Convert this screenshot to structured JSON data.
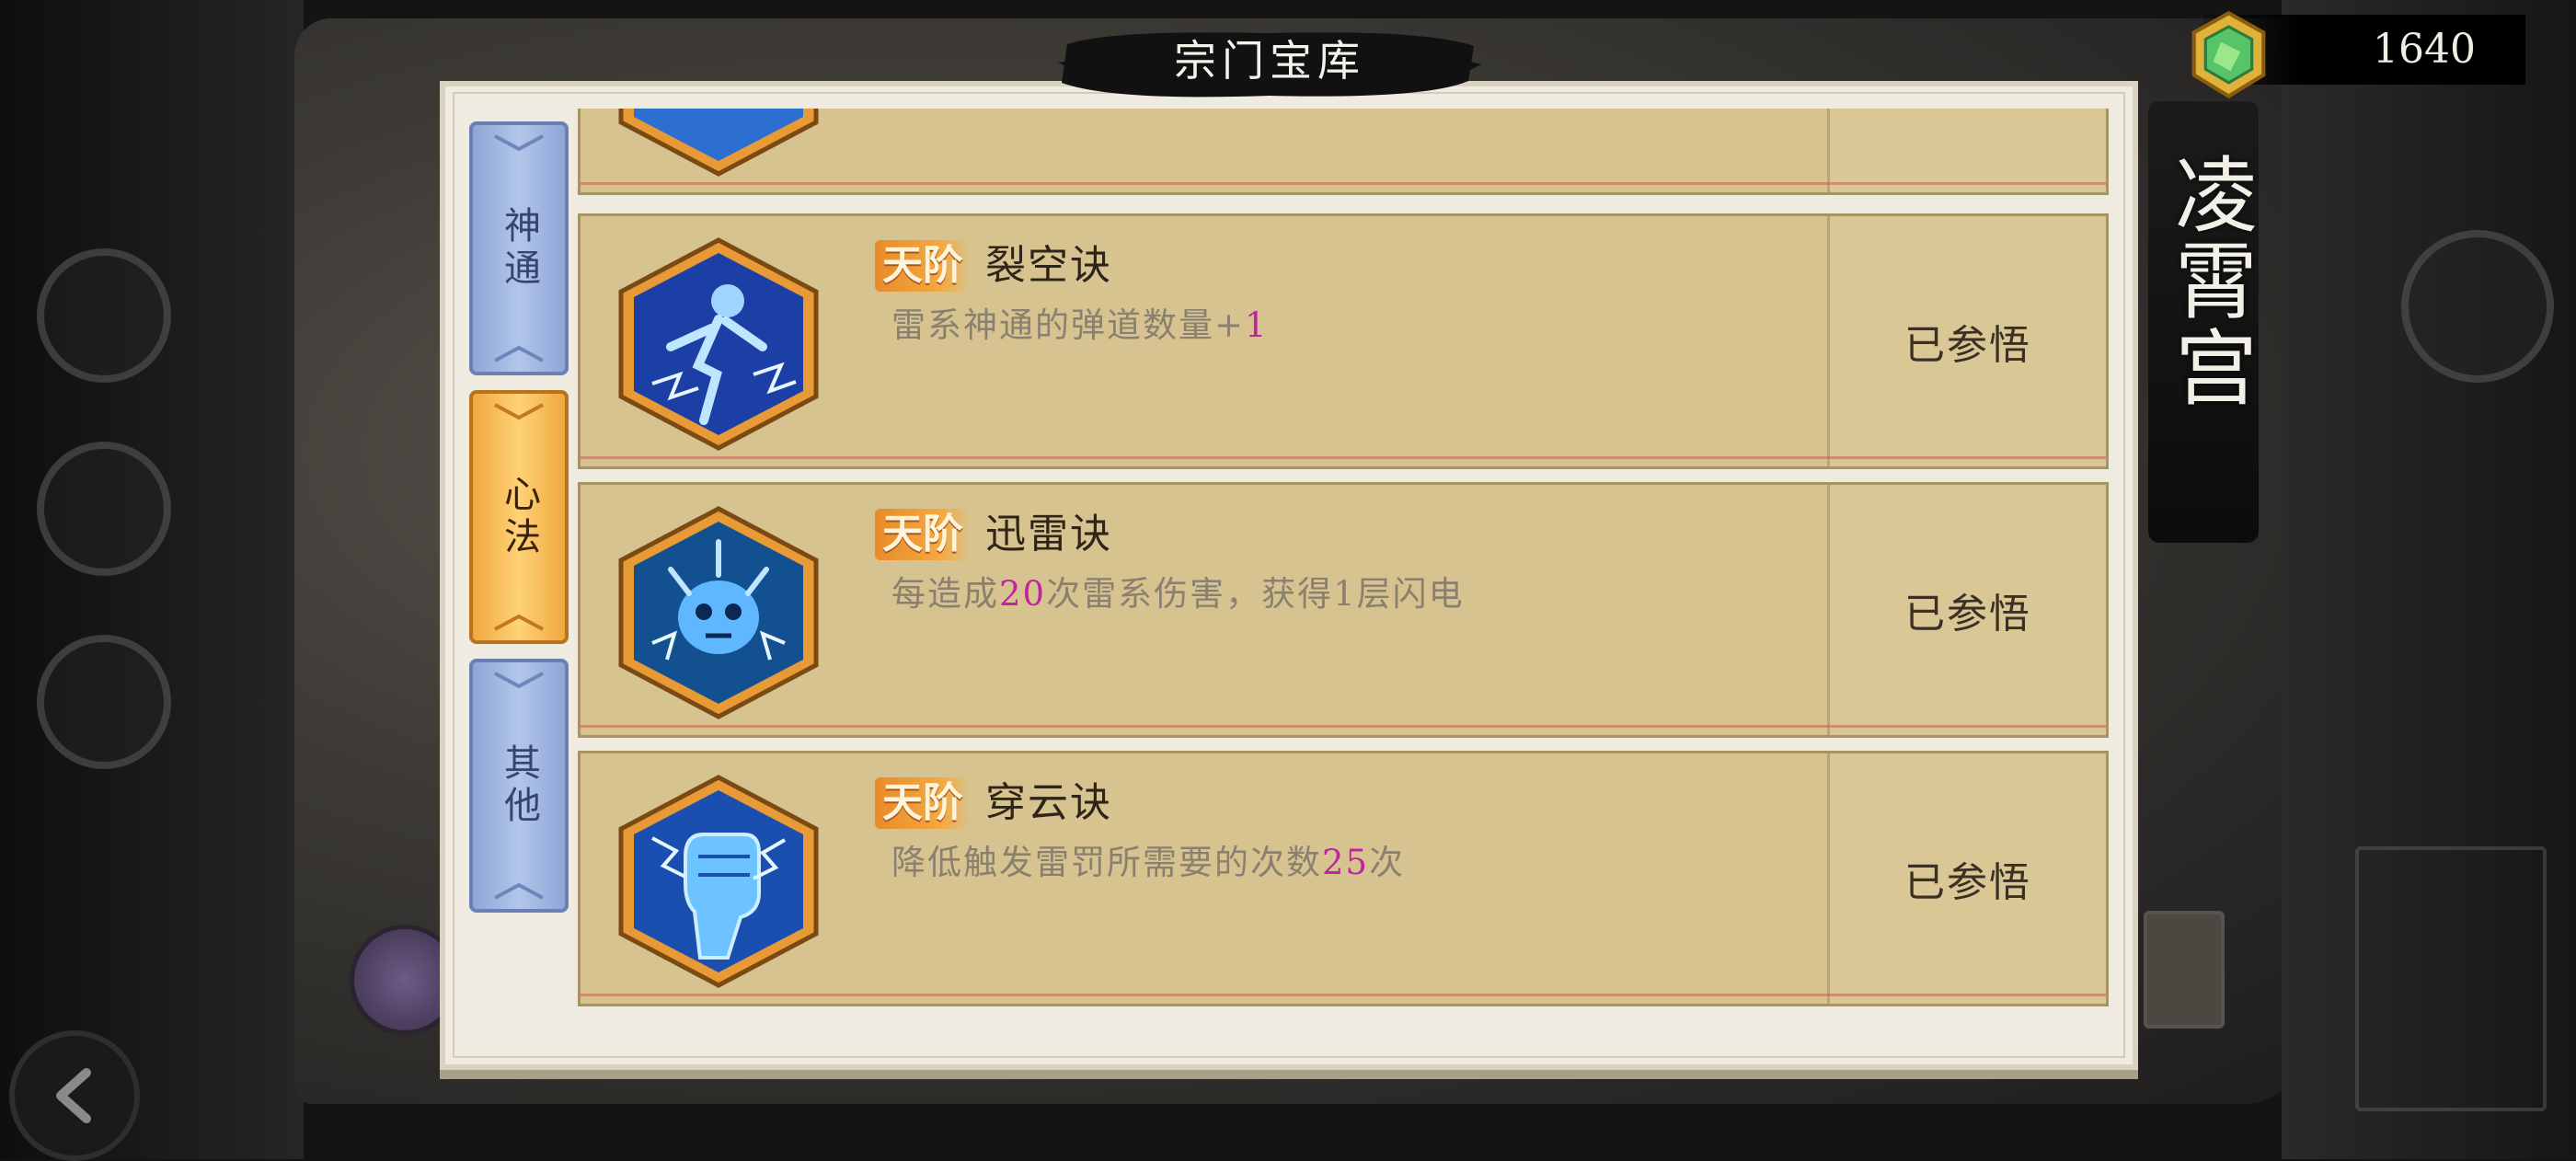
{
  "header": {
    "title": "宗门宝库",
    "currency_value": "1640",
    "sect_name": "凌霄宫"
  },
  "tabs": [
    {
      "label": "神通",
      "active": false
    },
    {
      "label": "心法",
      "active": true
    },
    {
      "label": "其他",
      "active": false
    }
  ],
  "skills": [
    {
      "grade": "天阶",
      "name": "裂空诀",
      "desc_parts": [
        "雷系神通的弹道数量+",
        "1",
        ""
      ],
      "status": "已参悟",
      "icon": "lightning-figure-icon"
    },
    {
      "grade": "天阶",
      "name": "迅雷诀",
      "desc_parts": [
        "每造成",
        "20",
        "次雷系伤害，获得1层闪电"
      ],
      "status": "已参悟",
      "icon": "thunder-skull-icon"
    },
    {
      "grade": "天阶",
      "name": "穿云诀",
      "desc_parts": [
        "降低触发雷罚所需要的次数",
        "25",
        "次"
      ],
      "status": "已参悟",
      "icon": "lightning-fist-icon"
    }
  ],
  "colors": {
    "highlight": "#c0249f",
    "grade_bg": "#f4a941",
    "card_bg": "#d6c38f",
    "tab_active": "#ffd277",
    "tab_inactive": "#b2c6ea"
  }
}
